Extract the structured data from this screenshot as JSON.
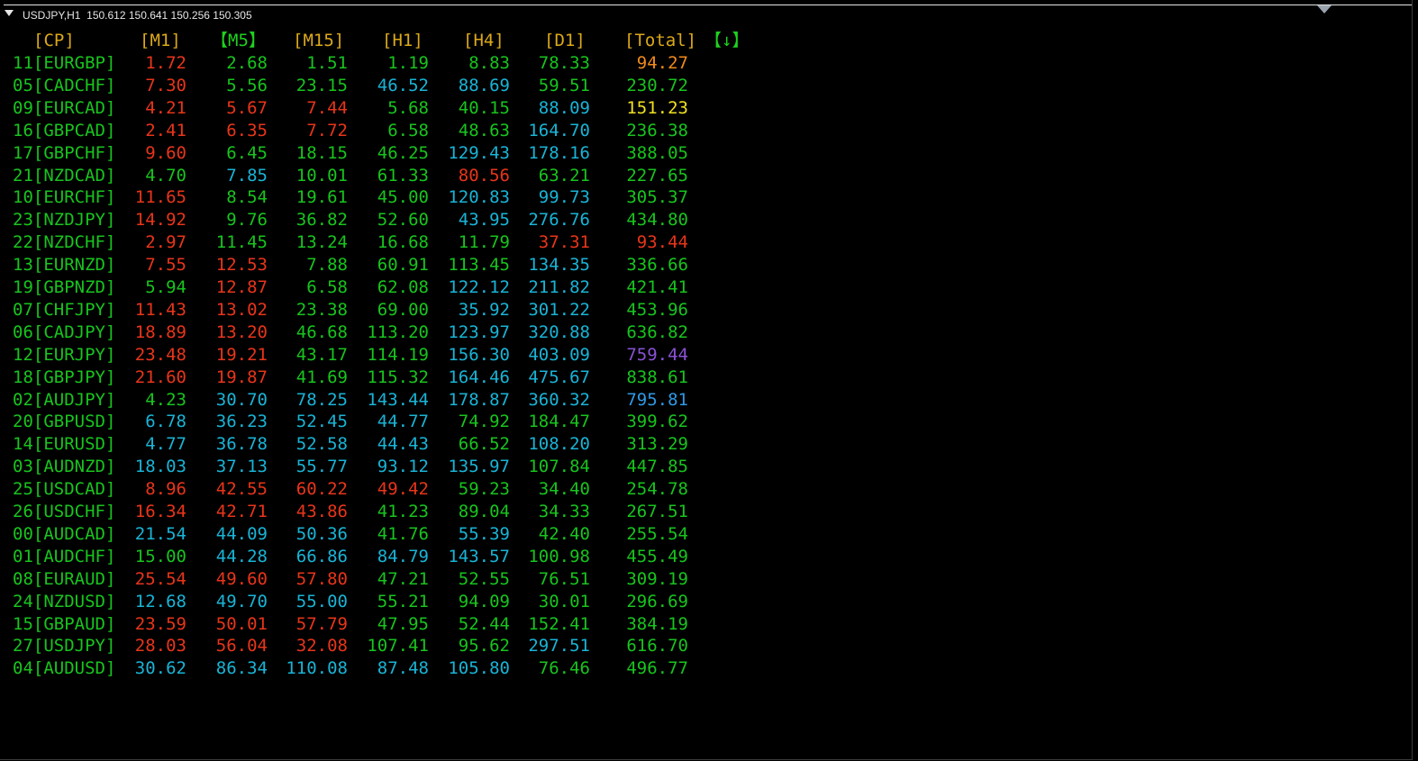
{
  "window": {
    "title": "USDJPY,H1  150.612 150.641 150.256 150.305"
  },
  "colors": {
    "green": "#18c41e",
    "red": "#e8351a",
    "cyan": "#19b4d6",
    "orange": "#f08a1a",
    "yellow": "#f0e020",
    "purple": "#8a52d6",
    "lightblue": "#2f99e6",
    "gold": "#dca81a",
    "header_green": "#1ed21e"
  },
  "headers": [
    {
      "text": "[CP]",
      "color": "gold"
    },
    {
      "text": "[M1]",
      "color": "gold"
    },
    {
      "text": "【M5】",
      "color": "header_green"
    },
    {
      "text": "[M15]",
      "color": "gold"
    },
    {
      "text": "[H1]",
      "color": "gold"
    },
    {
      "text": "[H4]",
      "color": "gold"
    },
    {
      "text": "[D1]",
      "color": "gold"
    },
    {
      "text": "[Total]",
      "color": "gold"
    },
    {
      "text": "【↓】",
      "color": "header_green"
    }
  ],
  "rows": [
    {
      "cp": "11[EURGBP]",
      "vals": [
        [
          "1.72",
          "red"
        ],
        [
          "2.68",
          "green"
        ],
        [
          "1.51",
          "green"
        ],
        [
          "1.19",
          "green"
        ],
        [
          "8.83",
          "green"
        ],
        [
          "78.33",
          "green"
        ],
        [
          "94.27",
          "orange"
        ]
      ]
    },
    {
      "cp": "05[CADCHF]",
      "vals": [
        [
          "7.30",
          "red"
        ],
        [
          "5.56",
          "green"
        ],
        [
          "23.15",
          "green"
        ],
        [
          "46.52",
          "cyan"
        ],
        [
          "88.69",
          "cyan"
        ],
        [
          "59.51",
          "green"
        ],
        [
          "230.72",
          "green"
        ]
      ]
    },
    {
      "cp": "09[EURCAD]",
      "vals": [
        [
          "4.21",
          "red"
        ],
        [
          "5.67",
          "red"
        ],
        [
          "7.44",
          "red"
        ],
        [
          "5.68",
          "green"
        ],
        [
          "40.15",
          "green"
        ],
        [
          "88.09",
          "cyan"
        ],
        [
          "151.23",
          "yellow"
        ]
      ]
    },
    {
      "cp": "16[GBPCAD]",
      "vals": [
        [
          "2.41",
          "red"
        ],
        [
          "6.35",
          "red"
        ],
        [
          "7.72",
          "red"
        ],
        [
          "6.58",
          "green"
        ],
        [
          "48.63",
          "green"
        ],
        [
          "164.70",
          "cyan"
        ],
        [
          "236.38",
          "green"
        ]
      ]
    },
    {
      "cp": "17[GBPCHF]",
      "vals": [
        [
          "9.60",
          "red"
        ],
        [
          "6.45",
          "green"
        ],
        [
          "18.15",
          "green"
        ],
        [
          "46.25",
          "green"
        ],
        [
          "129.43",
          "cyan"
        ],
        [
          "178.16",
          "cyan"
        ],
        [
          "388.05",
          "green"
        ]
      ]
    },
    {
      "cp": "21[NZDCAD]",
      "vals": [
        [
          "4.70",
          "green"
        ],
        [
          "7.85",
          "cyan"
        ],
        [
          "10.01",
          "green"
        ],
        [
          "61.33",
          "green"
        ],
        [
          "80.56",
          "red"
        ],
        [
          "63.21",
          "green"
        ],
        [
          "227.65",
          "green"
        ]
      ]
    },
    {
      "cp": "10[EURCHF]",
      "vals": [
        [
          "11.65",
          "red"
        ],
        [
          "8.54",
          "green"
        ],
        [
          "19.61",
          "green"
        ],
        [
          "45.00",
          "green"
        ],
        [
          "120.83",
          "cyan"
        ],
        [
          "99.73",
          "cyan"
        ],
        [
          "305.37",
          "green"
        ]
      ]
    },
    {
      "cp": "23[NZDJPY]",
      "vals": [
        [
          "14.92",
          "red"
        ],
        [
          "9.76",
          "green"
        ],
        [
          "36.82",
          "green"
        ],
        [
          "52.60",
          "green"
        ],
        [
          "43.95",
          "cyan"
        ],
        [
          "276.76",
          "cyan"
        ],
        [
          "434.80",
          "green"
        ]
      ]
    },
    {
      "cp": "22[NZDCHF]",
      "vals": [
        [
          "2.97",
          "red"
        ],
        [
          "11.45",
          "green"
        ],
        [
          "13.24",
          "green"
        ],
        [
          "16.68",
          "green"
        ],
        [
          "11.79",
          "green"
        ],
        [
          "37.31",
          "red"
        ],
        [
          "93.44",
          "red"
        ]
      ]
    },
    {
      "cp": "13[EURNZD]",
      "vals": [
        [
          "7.55",
          "red"
        ],
        [
          "12.53",
          "red"
        ],
        [
          "7.88",
          "green"
        ],
        [
          "60.91",
          "green"
        ],
        [
          "113.45",
          "green"
        ],
        [
          "134.35",
          "cyan"
        ],
        [
          "336.66",
          "green"
        ]
      ]
    },
    {
      "cp": "19[GBPNZD]",
      "vals": [
        [
          "5.94",
          "green"
        ],
        [
          "12.87",
          "red"
        ],
        [
          "6.58",
          "green"
        ],
        [
          "62.08",
          "green"
        ],
        [
          "122.12",
          "cyan"
        ],
        [
          "211.82",
          "cyan"
        ],
        [
          "421.41",
          "green"
        ]
      ]
    },
    {
      "cp": "07[CHFJPY]",
      "vals": [
        [
          "11.43",
          "red"
        ],
        [
          "13.02",
          "red"
        ],
        [
          "23.38",
          "green"
        ],
        [
          "69.00",
          "green"
        ],
        [
          "35.92",
          "cyan"
        ],
        [
          "301.22",
          "cyan"
        ],
        [
          "453.96",
          "green"
        ]
      ]
    },
    {
      "cp": "06[CADJPY]",
      "vals": [
        [
          "18.89",
          "red"
        ],
        [
          "13.20",
          "red"
        ],
        [
          "46.68",
          "green"
        ],
        [
          "113.20",
          "green"
        ],
        [
          "123.97",
          "cyan"
        ],
        [
          "320.88",
          "cyan"
        ],
        [
          "636.82",
          "green"
        ]
      ]
    },
    {
      "cp": "12[EURJPY]",
      "vals": [
        [
          "23.48",
          "red"
        ],
        [
          "19.21",
          "red"
        ],
        [
          "43.17",
          "green"
        ],
        [
          "114.19",
          "green"
        ],
        [
          "156.30",
          "cyan"
        ],
        [
          "403.09",
          "cyan"
        ],
        [
          "759.44",
          "purple"
        ]
      ]
    },
    {
      "cp": "18[GBPJPY]",
      "vals": [
        [
          "21.60",
          "red"
        ],
        [
          "19.87",
          "red"
        ],
        [
          "41.69",
          "green"
        ],
        [
          "115.32",
          "green"
        ],
        [
          "164.46",
          "cyan"
        ],
        [
          "475.67",
          "cyan"
        ],
        [
          "838.61",
          "green"
        ]
      ]
    },
    {
      "cp": "02[AUDJPY]",
      "vals": [
        [
          "4.23",
          "green"
        ],
        [
          "30.70",
          "cyan"
        ],
        [
          "78.25",
          "cyan"
        ],
        [
          "143.44",
          "cyan"
        ],
        [
          "178.87",
          "cyan"
        ],
        [
          "360.32",
          "cyan"
        ],
        [
          "795.81",
          "lightblue"
        ]
      ]
    },
    {
      "cp": "20[GBPUSD]",
      "vals": [
        [
          "6.78",
          "cyan"
        ],
        [
          "36.23",
          "cyan"
        ],
        [
          "52.45",
          "cyan"
        ],
        [
          "44.77",
          "cyan"
        ],
        [
          "74.92",
          "green"
        ],
        [
          "184.47",
          "green"
        ],
        [
          "399.62",
          "green"
        ]
      ]
    },
    {
      "cp": "14[EURUSD]",
      "vals": [
        [
          "4.77",
          "cyan"
        ],
        [
          "36.78",
          "cyan"
        ],
        [
          "52.58",
          "cyan"
        ],
        [
          "44.43",
          "cyan"
        ],
        [
          "66.52",
          "green"
        ],
        [
          "108.20",
          "cyan"
        ],
        [
          "313.29",
          "green"
        ]
      ]
    },
    {
      "cp": "03[AUDNZD]",
      "vals": [
        [
          "18.03",
          "cyan"
        ],
        [
          "37.13",
          "cyan"
        ],
        [
          "55.77",
          "cyan"
        ],
        [
          "93.12",
          "cyan"
        ],
        [
          "135.97",
          "cyan"
        ],
        [
          "107.84",
          "green"
        ],
        [
          "447.85",
          "green"
        ]
      ]
    },
    {
      "cp": "25[USDCAD]",
      "vals": [
        [
          "8.96",
          "red"
        ],
        [
          "42.55",
          "red"
        ],
        [
          "60.22",
          "red"
        ],
        [
          "49.42",
          "red"
        ],
        [
          "59.23",
          "green"
        ],
        [
          "34.40",
          "green"
        ],
        [
          "254.78",
          "green"
        ]
      ]
    },
    {
      "cp": "26[USDCHF]",
      "vals": [
        [
          "16.34",
          "red"
        ],
        [
          "42.71",
          "red"
        ],
        [
          "43.86",
          "red"
        ],
        [
          "41.23",
          "green"
        ],
        [
          "89.04",
          "green"
        ],
        [
          "34.33",
          "green"
        ],
        [
          "267.51",
          "green"
        ]
      ]
    },
    {
      "cp": "00[AUDCAD]",
      "vals": [
        [
          "21.54",
          "cyan"
        ],
        [
          "44.09",
          "cyan"
        ],
        [
          "50.36",
          "cyan"
        ],
        [
          "41.76",
          "green"
        ],
        [
          "55.39",
          "cyan"
        ],
        [
          "42.40",
          "green"
        ],
        [
          "255.54",
          "green"
        ]
      ]
    },
    {
      "cp": "01[AUDCHF]",
      "vals": [
        [
          "15.00",
          "green"
        ],
        [
          "44.28",
          "cyan"
        ],
        [
          "66.86",
          "cyan"
        ],
        [
          "84.79",
          "cyan"
        ],
        [
          "143.57",
          "cyan"
        ],
        [
          "100.98",
          "green"
        ],
        [
          "455.49",
          "green"
        ]
      ]
    },
    {
      "cp": "08[EURAUD]",
      "vals": [
        [
          "25.54",
          "red"
        ],
        [
          "49.60",
          "red"
        ],
        [
          "57.80",
          "red"
        ],
        [
          "47.21",
          "green"
        ],
        [
          "52.55",
          "green"
        ],
        [
          "76.51",
          "green"
        ],
        [
          "309.19",
          "green"
        ]
      ]
    },
    {
      "cp": "24[NZDUSD]",
      "vals": [
        [
          "12.68",
          "cyan"
        ],
        [
          "49.70",
          "cyan"
        ],
        [
          "55.00",
          "cyan"
        ],
        [
          "55.21",
          "green"
        ],
        [
          "94.09",
          "green"
        ],
        [
          "30.01",
          "green"
        ],
        [
          "296.69",
          "green"
        ]
      ]
    },
    {
      "cp": "15[GBPAUD]",
      "vals": [
        [
          "23.59",
          "red"
        ],
        [
          "50.01",
          "red"
        ],
        [
          "57.79",
          "red"
        ],
        [
          "47.95",
          "green"
        ],
        [
          "52.44",
          "green"
        ],
        [
          "152.41",
          "green"
        ],
        [
          "384.19",
          "green"
        ]
      ]
    },
    {
      "cp": "27[USDJPY]",
      "vals": [
        [
          "28.03",
          "red"
        ],
        [
          "56.04",
          "red"
        ],
        [
          "32.08",
          "red"
        ],
        [
          "107.41",
          "green"
        ],
        [
          "95.62",
          "green"
        ],
        [
          "297.51",
          "cyan"
        ],
        [
          "616.70",
          "green"
        ]
      ]
    },
    {
      "cp": "04[AUDUSD]",
      "vals": [
        [
          "30.62",
          "cyan"
        ],
        [
          "86.34",
          "cyan"
        ],
        [
          "110.08",
          "cyan"
        ],
        [
          "87.48",
          "cyan"
        ],
        [
          "105.80",
          "cyan"
        ],
        [
          "76.46",
          "green"
        ],
        [
          "496.77",
          "green"
        ]
      ]
    }
  ]
}
